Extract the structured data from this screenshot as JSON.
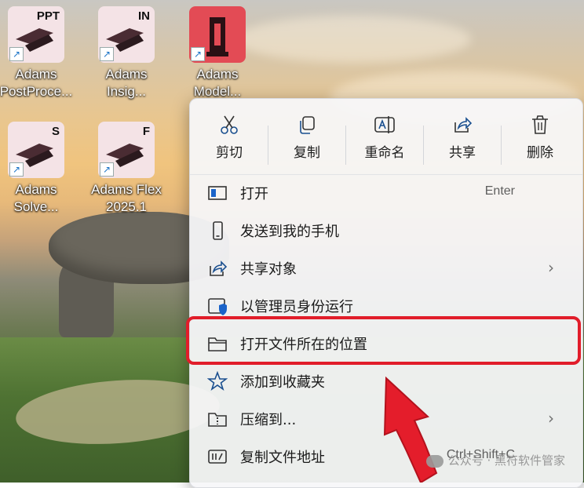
{
  "desktop_icons": [
    {
      "badge": "PPT",
      "label": "Adams\nPostProce..."
    },
    {
      "badge": "IN",
      "label": "Adams\nInsig..."
    },
    {
      "badge": "",
      "label": "Adams\nModel..."
    },
    {
      "badge": "S",
      "label": "Adams\nSolve..."
    },
    {
      "badge": "F",
      "label": "Adams Flex\n2025.1"
    }
  ],
  "toolbar": [
    {
      "label": "剪切",
      "icon": "scissors-icon"
    },
    {
      "label": "复制",
      "icon": "copy-icon"
    },
    {
      "label": "重命名",
      "icon": "rename-icon"
    },
    {
      "label": "共享",
      "icon": "share-icon"
    },
    {
      "label": "删除",
      "icon": "trash-icon"
    }
  ],
  "menu_items": [
    {
      "label": "打开",
      "shortcut": "Enter",
      "icon": "open-window-icon"
    },
    {
      "label": "发送到我的手机",
      "icon": "phone-icon"
    },
    {
      "label": "共享对象",
      "icon": "share-icon",
      "submenu": "›"
    },
    {
      "label": "以管理员身份运行",
      "icon": "admin-shield-icon"
    },
    {
      "label": "打开文件所在的位置",
      "icon": "folder-icon"
    },
    {
      "label": "添加到收藏夹",
      "icon": "star-icon"
    },
    {
      "label": "压缩到...",
      "icon": "archive-icon",
      "submenu": "›"
    },
    {
      "label": "复制文件地址",
      "shortcut": "Ctrl+Shift+C",
      "icon": "copy-path-icon"
    }
  ],
  "watermark": "公众号 · 黑符软件管家",
  "colors": {
    "highlight": "#e11d2a",
    "menu_bg": "#f6f7f9",
    "accent": "#0a63c9"
  }
}
